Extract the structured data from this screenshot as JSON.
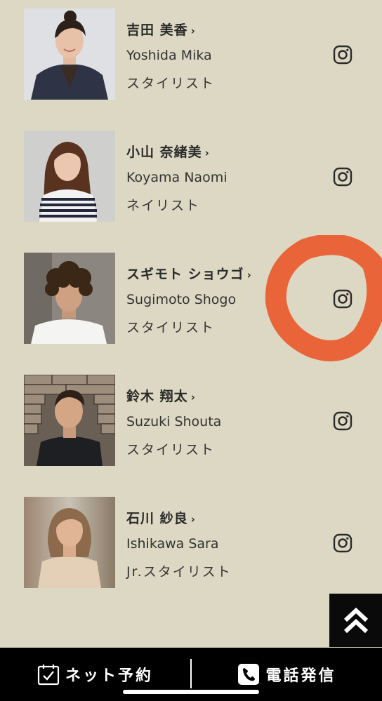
{
  "staff": [
    {
      "name_jp": "吉田 美香",
      "name_en": "Yoshida Mika",
      "role": "スタイリスト",
      "icon": "instagram-icon"
    },
    {
      "name_jp": "小山 奈緒美",
      "name_en": "Koyama Naomi",
      "role": "ネイリスト",
      "icon": "instagram-icon"
    },
    {
      "name_jp": "スギモト ショウゴ",
      "name_en": "Sugimoto Shogo",
      "role": "スタイリスト",
      "icon": "instagram-icon"
    },
    {
      "name_jp": "鈴木 翔太",
      "name_en": "Suzuki Shouta",
      "role": "スタイリスト",
      "icon": "instagram-icon"
    },
    {
      "name_jp": "石川 紗良",
      "name_en": "Ishikawa Sara",
      "role": "Jr.スタイリスト",
      "icon": "instagram-icon"
    }
  ],
  "chevron": "›",
  "bottom_bar": {
    "reserve_label": "ネット予約",
    "call_label": "電話発信"
  },
  "colors": {
    "background": "#ddd8c3",
    "bar": "#000000",
    "scribble": "#ea5a2e"
  }
}
